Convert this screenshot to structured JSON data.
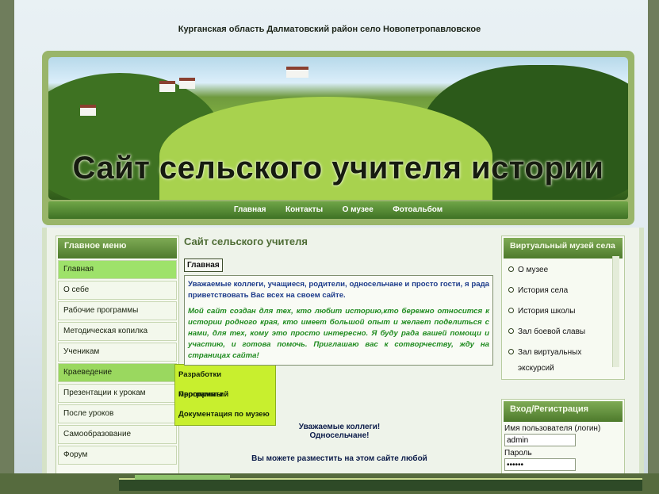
{
  "site": {
    "region_title": "Курганская область Далматовский район село Новопетропавловское",
    "banner_title": "Сайт сельского учителя истории"
  },
  "nav": {
    "items": [
      "Главная",
      "Контакты",
      "О музее",
      "Фотоальбом"
    ]
  },
  "left_menu": {
    "header": "Главное меню",
    "items": [
      "Главная",
      "О себе",
      "Рабочие программы",
      "Методическая копилка",
      "Ученикам",
      "Краеведение",
      "Презентации к урокам",
      "После уроков",
      "Самообразование",
      "Форум"
    ],
    "submenu": [
      "Разработки мероприятий",
      "Программы",
      "Документация по музею"
    ]
  },
  "main": {
    "title": "Сайт сельского учителя",
    "breadcrumb": "Главная",
    "paragraph1": "Уважаемые коллеги, учащиеся, родители, односельчане и просто гости, я рада приветствовать Вас всех на своем сайте.",
    "paragraph2": "Мой сайт создан для тех, кто любит историю,кто бережно относится к истории родного края, кто имеет большой опыт и желает поделиться с нами, для тех, кому это просто интересно. Я буду рада вашей помощи и участию, и готова помочь. Приглашаю вас к сотворчеству, жду на страницах сайта!",
    "greeting_line1": "Уважаемые коллеги!",
    "greeting_line2": "Односельчане!",
    "greeting_line3": "Вы можете разместить на этом сайте любой"
  },
  "museum": {
    "header": "Виртуальный музей села",
    "items": [
      "О музее",
      "История села",
      "История школы",
      "Зал боевой славы",
      "Зал виртуальных экскурсий"
    ]
  },
  "login": {
    "header": "Вход/Регистрация",
    "username_label": "Имя пользователя (логин)",
    "username_value": "admin",
    "password_label": "Пароль",
    "password_value": "••••••"
  }
}
